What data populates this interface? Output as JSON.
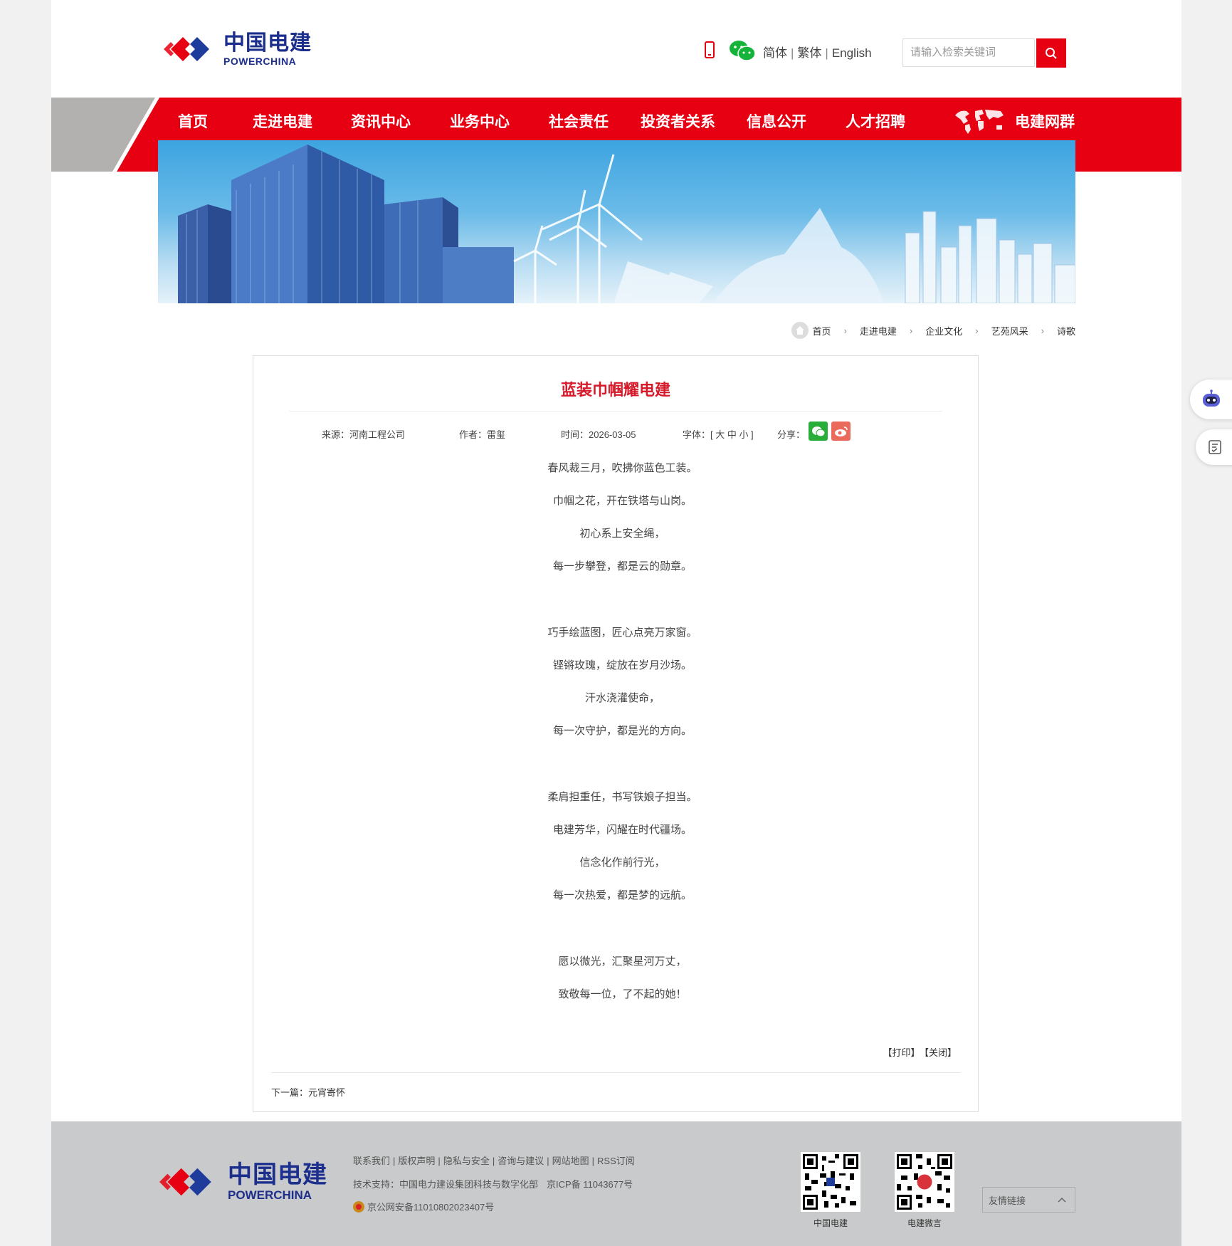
{
  "header": {
    "logo_cn": "中国电建",
    "logo_en": "POWERCHINA",
    "lang": [
      "简体",
      "繁体",
      "English"
    ],
    "search_placeholder": "请输入检索关键词"
  },
  "nav": {
    "items": [
      "首页",
      "走进电建",
      "资讯中心",
      "业务中心",
      "社会责任",
      "投资者关系",
      "信息公开",
      "人才招聘"
    ],
    "group": "电建网群"
  },
  "breadcrumb": [
    "首页",
    "走进电建",
    "企业文化",
    "艺苑风采",
    "诗歌"
  ],
  "article": {
    "title": "蓝装巾帼耀电建",
    "source": "来源：河南工程公司",
    "author": "作者：雷玺",
    "time": "时间：2026-03-05",
    "font_size": "字体：[ 大 中 小 ]",
    "share": "分享：",
    "lines": [
      "春风裁三月，吹拂你蓝色工装。",
      "巾帼之花，开在铁塔与山岗。",
      "初心系上安全绳，",
      "每一步攀登，都是云的勋章。",
      "巧手绘蓝图，匠心点亮万家窗。",
      "铿锵玫瑰，绽放在岁月沙场。",
      "汗水浇灌使命，",
      "每一次守护，都是光的方向。",
      "柔肩担重任，书写铁娘子担当。",
      "电建芳华，闪耀在时代疆场。",
      "信念化作前行光，",
      "每一次热爱，都是梦的远航。",
      "愿以微光，汇聚星河万丈，",
      "致敬每一位，了不起的她！"
    ],
    "print": "【打印】",
    "close": "【关闭】",
    "next": "下一篇：元宵寄怀"
  },
  "footer": {
    "logo_cn": "中国电建",
    "logo_en": "POWERCHINA",
    "links": [
      "联系我们",
      "版权声明",
      "隐私与安全",
      "咨询与建议",
      "网站地图",
      "RSS订阅"
    ],
    "tech": "技术支持：中国电力建设集团科技与数字化部",
    "icp": "京ICP备 11043677号",
    "police": "京公网安备11010802023407号",
    "qr1": "中国电建",
    "qr2": "电建微言",
    "friend_links": "友情链接"
  },
  "colors": {
    "brand_red": "#e60012",
    "brand_blue": "#1d2f8c",
    "title_red": "#d6192b"
  }
}
